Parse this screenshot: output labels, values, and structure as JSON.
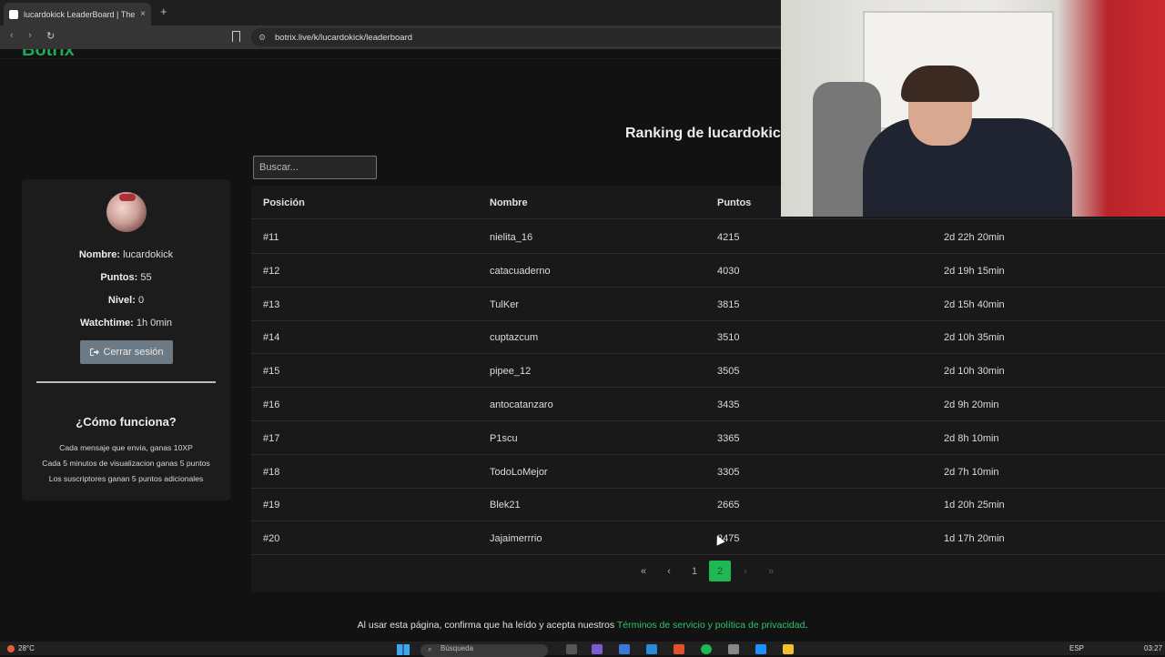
{
  "browser": {
    "tab_title": "lucardokick LeaderBoard | The b",
    "tab_close": "×",
    "new_tab": "+",
    "back": "‹",
    "forward": "›",
    "reload": "↻",
    "url": "botrix.live/k/lucardokick/leaderboard"
  },
  "site": {
    "logo": "Botrix"
  },
  "page": {
    "heading": "Ranking de lucardokick",
    "search_placeholder": "Buscar..."
  },
  "profile": {
    "name_label": "Nombre:",
    "name_value": "lucardokick",
    "points_label": "Puntos:",
    "points_value": "55",
    "level_label": "Nivel:",
    "level_value": "0",
    "watchtime_label": "Watchtime:",
    "watchtime_value": "1h 0min",
    "logout_icon": "sign-out-icon",
    "logout_label": "Cerrar sesión"
  },
  "howto": {
    "title": "¿Cómo funciona?",
    "rules": [
      "Cada mensaje que envia, ganas 10XP",
      "Cada 5 minutos de visualizacion ganas 5 puntos",
      "Los suscriptores ganan 5 puntos adicionales"
    ]
  },
  "table": {
    "headers": [
      "Posición",
      "Nombre",
      "Puntos"
    ],
    "rows": [
      {
        "pos": "#11",
        "name": "nielita_16",
        "points": "4215",
        "time": "2d 22h 20min"
      },
      {
        "pos": "#12",
        "name": "catacuaderno",
        "points": "4030",
        "time": "2d 19h 15min"
      },
      {
        "pos": "#13",
        "name": "TulKer",
        "points": "3815",
        "time": "2d 15h 40min"
      },
      {
        "pos": "#14",
        "name": "cuptazcum",
        "points": "3510",
        "time": "2d 10h 35min"
      },
      {
        "pos": "#15",
        "name": "pipee_12",
        "points": "3505",
        "time": "2d 10h 30min"
      },
      {
        "pos": "#16",
        "name": "antocatanzaro",
        "points": "3435",
        "time": "2d 9h 20min"
      },
      {
        "pos": "#17",
        "name": "P1scu",
        "points": "3365",
        "time": "2d 8h 10min"
      },
      {
        "pos": "#18",
        "name": "TodoLoMejor",
        "points": "3305",
        "time": "2d 7h 10min"
      },
      {
        "pos": "#19",
        "name": "Blek21",
        "points": "2665",
        "time": "1d 20h 25min"
      },
      {
        "pos": "#20",
        "name": "Jajaimerrrio",
        "points": "2475",
        "time": "1d 17h 20min"
      }
    ]
  },
  "pagination": {
    "first": "«",
    "prev": "‹",
    "page1": "1",
    "page2": "2",
    "next": "›",
    "last": "»",
    "current": 2
  },
  "footer": {
    "text": "Al usar esta página, confirma que ha leído y acepta nuestros ",
    "link": "Términos de servicio y política de privacidad",
    "end": "."
  },
  "taskbar": {
    "weather": "28°C",
    "search_label": "Búsqueda",
    "language": "ESP",
    "clock": "03:27"
  },
  "colors": {
    "accent": "#1fb954",
    "logout_button": "#6c7a86",
    "link": "#2fc26a"
  }
}
